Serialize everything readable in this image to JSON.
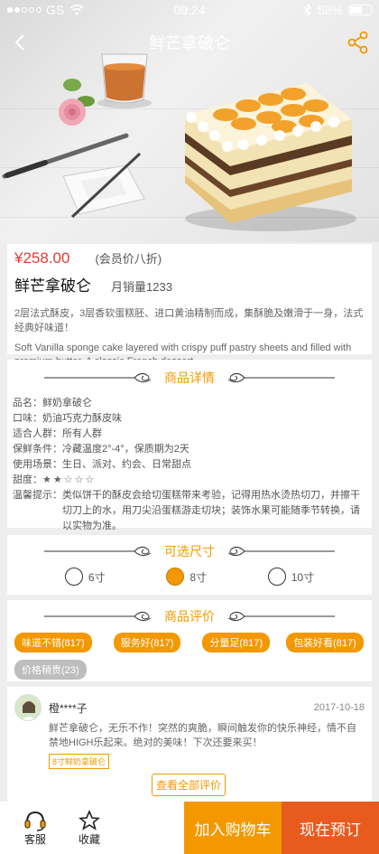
{
  "status": {
    "carrier": "GS",
    "time": "09:24",
    "battery": "58%"
  },
  "nav": {
    "title": "鲜芒拿破仑"
  },
  "product": {
    "price": "¥258.00",
    "member_price": "(会员价八折)",
    "name": "鲜芒拿破仑",
    "monthly_sales": "月销量1233",
    "description": "2层法式酥皮，3层香软蛋糕胚、进口黄油精制而成，集酥脆及嫩滑于一身，法式经典好味道！",
    "description_en": "Soft Vanilla sponge cake layered with crispy puff pastry sheets and filled with premium butter. A classic French dessert."
  },
  "details": {
    "title": "商品详情",
    "rows": [
      {
        "k": "品名：",
        "v": "鲜奶拿破仑"
      },
      {
        "k": "口味：",
        "v": "奶油巧克力酥皮味"
      },
      {
        "k": "适合人群：",
        "v": "所有人群"
      },
      {
        "k": "保鲜条件：",
        "v": "冷藏温度2°-4°，保质期为2天"
      },
      {
        "k": "使用场景：",
        "v": "生日、派对、约会、日常甜点"
      },
      {
        "k": "甜度：",
        "v": "★★☆☆☆"
      },
      {
        "k": "温馨提示：",
        "v": "类似饼干的酥皮会给切蛋糕带来考验，记得用热水烫热切刀，并擦干切刀上的水，用刀尖沿蛋糕游走切块；装饰水果可能随季节转换，请以实物为准。"
      }
    ]
  },
  "sizes": {
    "title": "可选尺寸",
    "options": [
      "6寸",
      "8寸",
      "10寸"
    ],
    "selected": "8寸"
  },
  "reviews": {
    "title": "商品评价",
    "tags": [
      "味道不错(817)",
      "服务好(817)",
      "分量足(817)",
      "包装好看(817)",
      "价格稍贵(23)"
    ],
    "item": {
      "user": "橙****子",
      "date": "2017-10-18",
      "text": "鲜芒拿破仑，无乐不作！突然的爽脆，瞬间触发你的快乐神经，情不自禁地HIGH乐起来。绝对的美味！下次还要来买！",
      "spec": "8寸鲜奶拿破仑"
    },
    "view_all": "查看全部评价"
  },
  "bottom": {
    "service": "客服",
    "favorite": "收藏",
    "add_cart": "加入购物车",
    "buy_now": "现在预订"
  },
  "colors": {
    "accent": "#f39800",
    "price": "#e53935",
    "buy": "#e85b1f"
  }
}
